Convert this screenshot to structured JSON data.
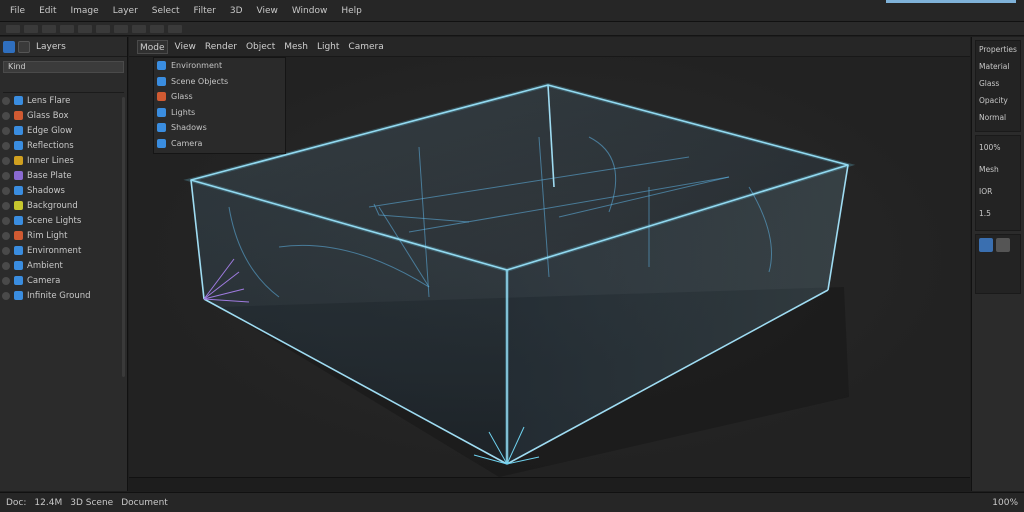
{
  "menu": [
    "File",
    "Edit",
    "Image",
    "Layer",
    "Select",
    "Filter",
    "3D",
    "View",
    "Window",
    "Help"
  ],
  "left_panel": {
    "title": "Layers",
    "search": "Kind",
    "layers": [
      {
        "label": "Lens Flare",
        "color": "#3a8de0"
      },
      {
        "label": "Glass Box",
        "color": "#d05a32"
      },
      {
        "label": "Edge Glow",
        "color": "#3a8de0"
      },
      {
        "label": "Reflections",
        "color": "#3a8de0"
      },
      {
        "label": "Inner Lines",
        "color": "#d0a020"
      },
      {
        "label": "Base Plate",
        "color": "#8a6ad0"
      },
      {
        "label": "Shadows",
        "color": "#3a8de0"
      },
      {
        "label": "Background",
        "color": "#c7c72e"
      },
      {
        "label": "Scene Lights",
        "color": "#3a8de0"
      },
      {
        "label": "Rim Light",
        "color": "#d05a32"
      },
      {
        "label": "Environment",
        "color": "#3a8de0"
      },
      {
        "label": "Ambient",
        "color": "#3a8de0"
      },
      {
        "label": "Camera",
        "color": "#3a8de0"
      },
      {
        "label": "Infinite Ground",
        "color": "#3a8de0"
      }
    ]
  },
  "viewport": {
    "toolbar": [
      "Mode",
      "View",
      "Render",
      "Object",
      "Mesh",
      "Light",
      "Camera"
    ],
    "dropdown": [
      {
        "label": "Environment",
        "color": "#3a8de0"
      },
      {
        "label": "Scene Objects",
        "color": "#3a8de0"
      },
      {
        "label": "Glass",
        "color": "#d05a32"
      },
      {
        "label": "Lights",
        "color": "#3a8de0"
      },
      {
        "label": "Shadows",
        "color": "#3a8de0"
      },
      {
        "label": "Camera",
        "color": "#3a8de0"
      }
    ]
  },
  "right_panel": {
    "rows": [
      "Properties",
      "Material",
      "Glass",
      "Opacity",
      "Normal"
    ],
    "values": [
      "100%",
      "Mesh",
      "IOR",
      "1.5"
    ]
  },
  "status": {
    "left": [
      "Doc:",
      "12.4M",
      "3D Scene",
      "Document"
    ],
    "right": "100%"
  },
  "colors": {
    "accent": "#7fb2d9",
    "glass": "#8cc8e8",
    "edge_glow": "#6fd3f0",
    "violet": "#9f7be0"
  }
}
